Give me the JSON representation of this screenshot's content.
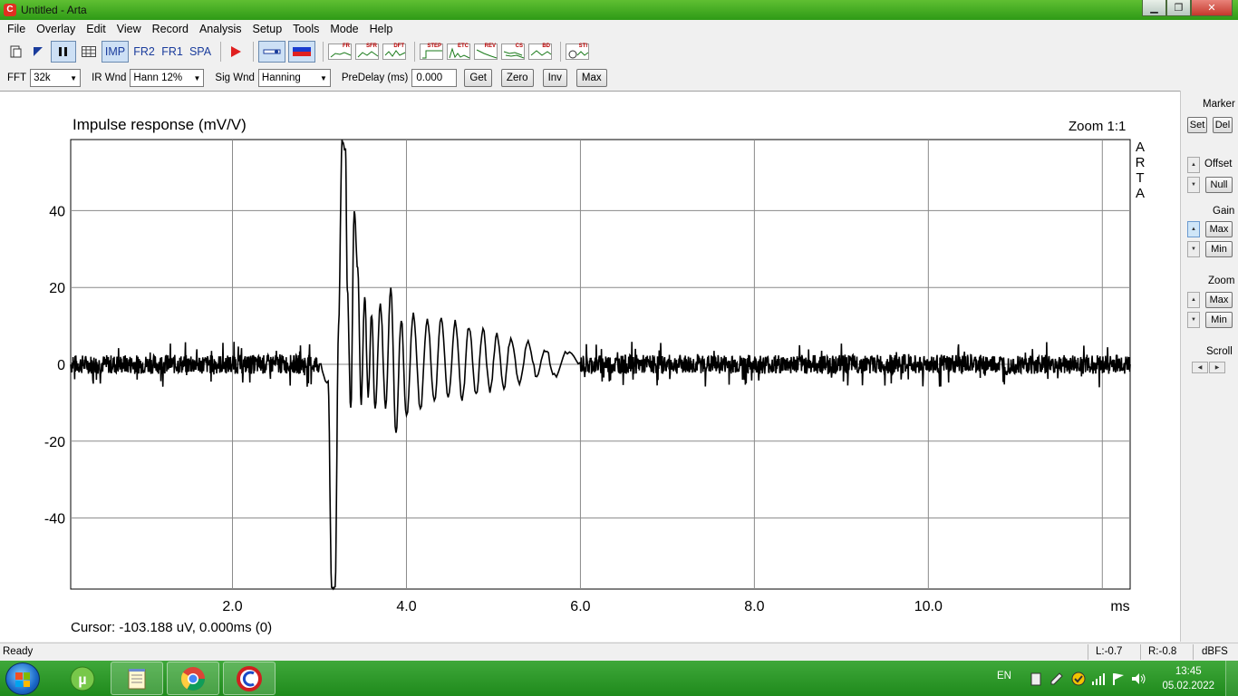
{
  "window": {
    "title": "Untitled - Arta",
    "app_icon": "arta-logo-icon",
    "controls": {
      "minimize": "minimize-icon",
      "maximize": "restore-icon",
      "close": "close-icon"
    }
  },
  "menu": [
    "File",
    "Overlay",
    "Edit",
    "View",
    "Record",
    "Analysis",
    "Setup",
    "Tools",
    "Mode",
    "Help"
  ],
  "toolbar": {
    "mode_buttons": [
      "IMP",
      "FR2",
      "FR1",
      "SPA"
    ],
    "active_mode": "IMP",
    "analysis_buttons": [
      "FR",
      "SFR",
      "DFT",
      "STEP",
      "ETC",
      "REV",
      "CS",
      "BD",
      "STI"
    ]
  },
  "params": {
    "fft_label": "FFT",
    "fft_value": "32k",
    "ir_wnd_label": "IR Wnd",
    "ir_wnd_value": "Hann 12%",
    "sig_wnd_label": "Sig Wnd",
    "sig_wnd_value": "Hanning",
    "predelay_label": "PreDelay (ms)",
    "predelay_value": "0.000",
    "buttons": {
      "get": "Get",
      "zero": "Zero",
      "inv": "Inv",
      "max": "Max"
    }
  },
  "plot": {
    "title": "Impulse response (mV/V)",
    "zoom": "Zoom 1:1",
    "watermark": [
      "A",
      "R",
      "T",
      "A"
    ],
    "cursor": "Cursor: -103.188 uV, 0.000ms (0)"
  },
  "chart_data": {
    "type": "line",
    "title": "Impulse response (mV/V)",
    "xlabel": "ms",
    "ylabel": "",
    "xlim": [
      0.14,
      12.32
    ],
    "ylim": [
      -58.5,
      58.5
    ],
    "x_ticks": [
      2.0,
      4.0,
      6.0,
      8.0,
      10.0,
      12.0
    ],
    "x_tick_labels": [
      "2.0",
      "4.0",
      "6.0",
      "8.0",
      "10.0",
      "ms"
    ],
    "y_ticks": [
      40,
      20,
      0,
      -20,
      -40
    ],
    "y_tick_labels": [
      "40",
      "20",
      "0",
      "-20",
      "-40"
    ],
    "grid": true,
    "series": [
      {
        "values_description_free": true,
        "x": [
          0.14,
          3.0,
          3.1,
          3.14,
          3.18,
          3.22,
          3.26,
          3.3,
          3.32,
          3.36,
          3.4,
          3.44,
          3.48,
          3.52,
          3.56,
          3.6,
          3.64,
          3.7,
          3.76,
          3.82,
          3.88,
          3.94,
          4.0,
          4.08,
          4.16,
          4.24,
          4.32,
          4.4,
          4.48,
          4.56,
          4.64,
          4.72,
          4.8,
          4.88,
          4.96,
          5.04,
          5.12,
          5.2,
          5.3,
          5.4,
          5.5,
          5.6,
          5.7,
          5.85,
          6.0,
          12.32
        ],
        "y": [
          0,
          0,
          -5,
          -58,
          -58,
          10,
          58,
          56,
          20,
          -12,
          40,
          25,
          -10,
          18,
          -8,
          13,
          -12,
          16,
          -11,
          20,
          -18,
          12,
          -14,
          13,
          -12,
          12,
          -10,
          12,
          -9,
          11,
          -9,
          10,
          -8,
          9,
          -7,
          8,
          -6,
          7,
          -5,
          6,
          -3,
          4,
          -3,
          3,
          0,
          0
        ]
      }
    ]
  },
  "right_panel": {
    "marker_label": "Marker",
    "set": "Set",
    "del": "Del",
    "offset_label": "Offset",
    "null": "Null",
    "gain_label": "Gain",
    "gain_max": "Max",
    "gain_min": "Min",
    "zoom_label": "Zoom",
    "zoom_max": "Max",
    "zoom_min": "Min",
    "scroll_label": "Scroll"
  },
  "status": {
    "ready": "Ready",
    "left": "L:-0.7",
    "right": "R:-0.8",
    "unit": "dBFS"
  },
  "taskbar": {
    "apps": [
      "utorrent-icon",
      "notepad-icon",
      "chrome-icon",
      "arta-icon"
    ],
    "lang": "EN",
    "time": "13:45",
    "date": "05.02.2022"
  }
}
